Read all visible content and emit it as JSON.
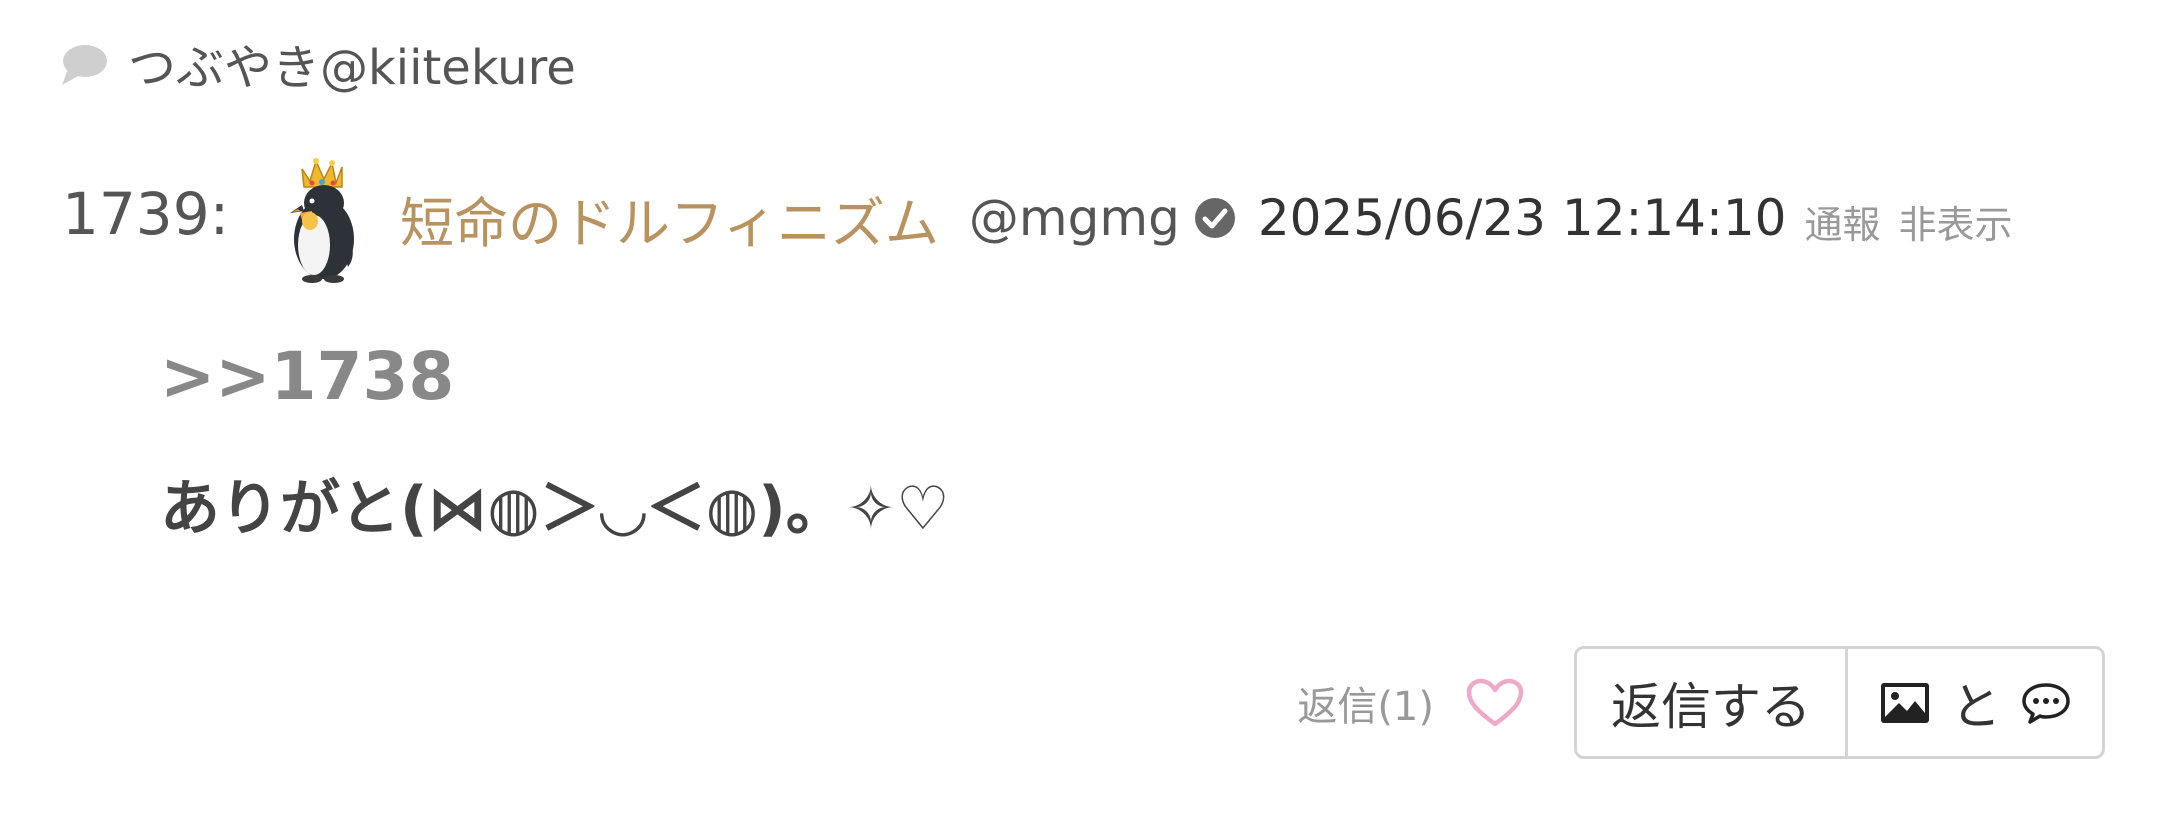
{
  "header": {
    "title": "つぶやき@kiitekure",
    "icon": "speech-bubble-icon"
  },
  "post": {
    "number": "1739:",
    "avatar": "penguin-with-crown",
    "user_name": "短命のドルフィニズム",
    "handle": "@mgmg",
    "verified_icon": "check-circle-icon",
    "timestamp": "2025/06/23 12:14:10",
    "report_label": "通報",
    "hide_label": "非表示",
    "anchor": ">>1738",
    "message": "ありがと(⋈◍＞◡＜◍)。✧♡"
  },
  "actions": {
    "reply_count": "返信(1)",
    "like_icon": "heart-outline-icon",
    "reply_button": "返信する",
    "image_reply_connector": "と",
    "image_icon": "image-icon",
    "chat_icon": "chat-bubble-icon"
  },
  "colors": {
    "user_name": "#b8935f",
    "heart": "#f0a8c8",
    "muted": "#999999",
    "button_border": "#d4d4d4"
  }
}
